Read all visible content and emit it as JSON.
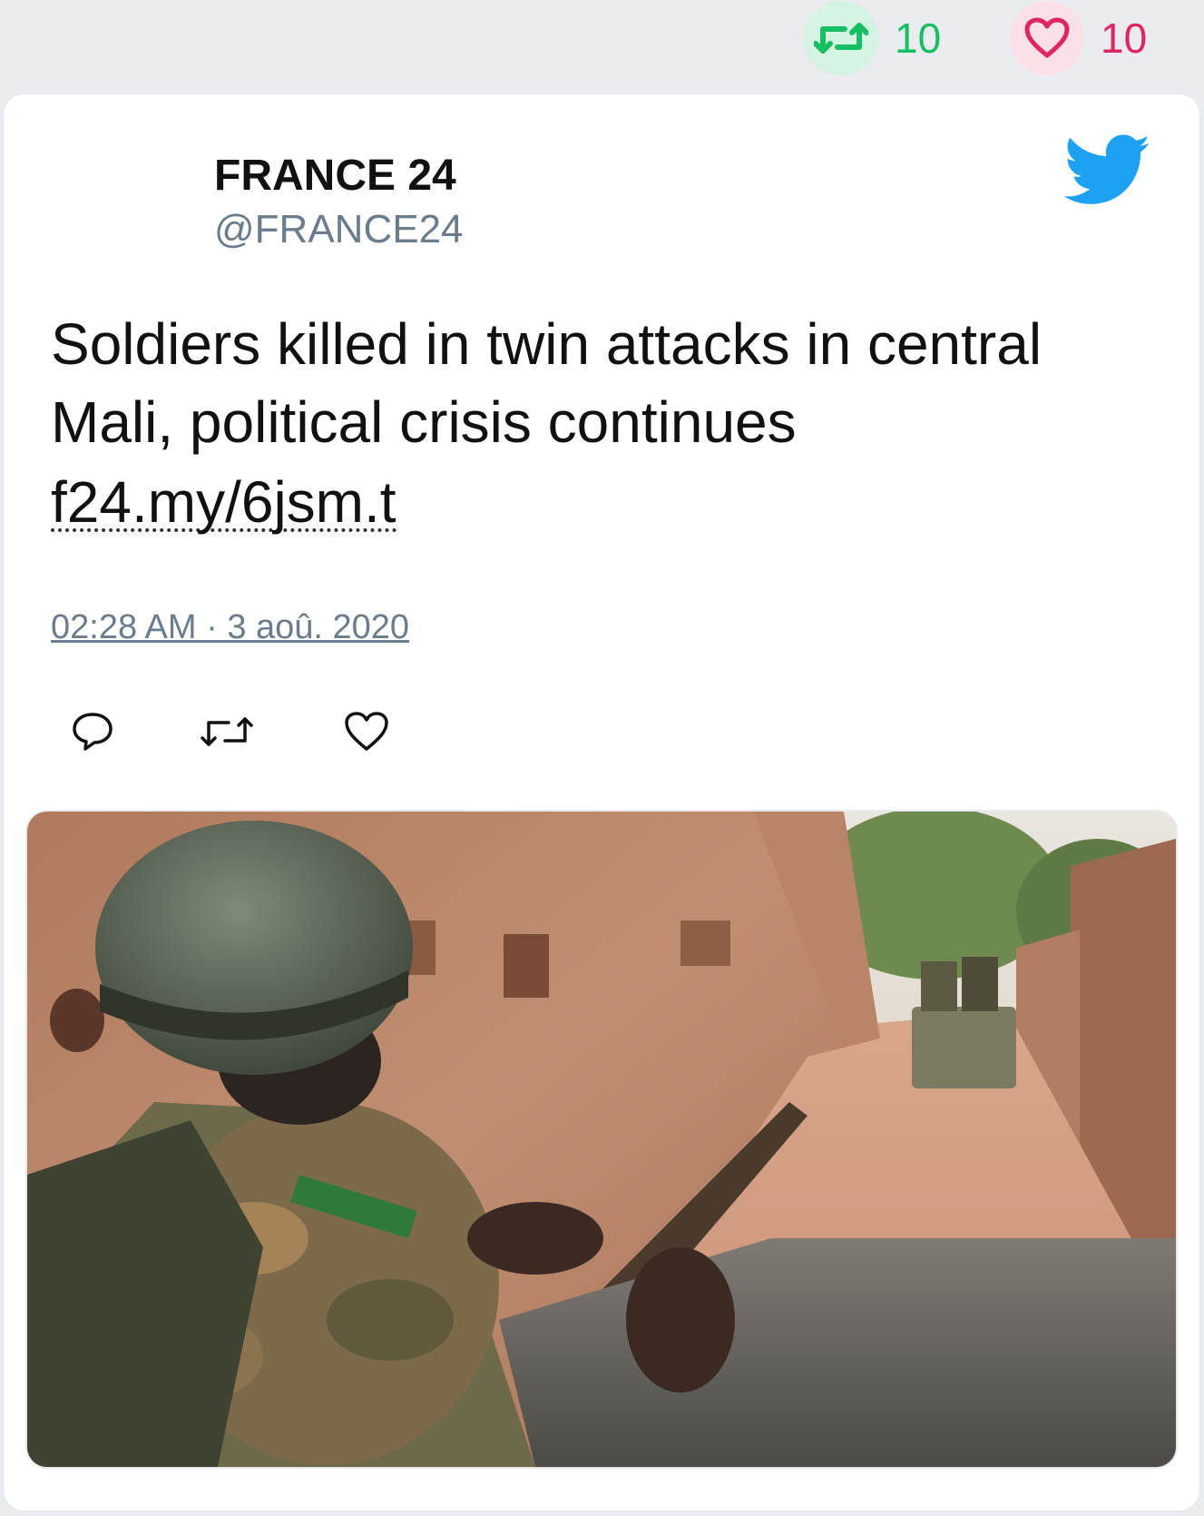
{
  "stats": {
    "retweet_count": "10",
    "like_count": "10"
  },
  "tweet": {
    "author_name": "FRANCE 24",
    "author_handle": "@FRANCE24",
    "text": "Soldiers killed in twin attacks in central Mali, political crisis continues",
    "link": "f24.my/6jsm.t",
    "timestamp": "02:28 AM · 3 aoû. 2020"
  },
  "icons": {
    "brand": "twitter-bird-icon",
    "reply": "reply-icon",
    "retweet": "retweet-icon",
    "like": "heart-icon"
  },
  "colors": {
    "twitter_blue": "#1da1f2",
    "retweet_green": "#17bf63",
    "like_red": "#e0245e",
    "muted_text": "#6b7c8d",
    "page_bg": "#eaecef"
  }
}
